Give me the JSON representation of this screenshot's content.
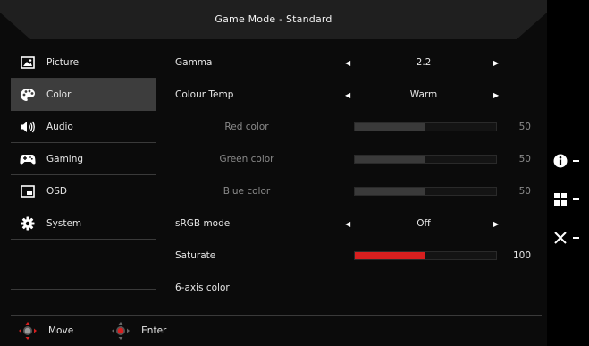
{
  "header": {
    "title": "Game Mode - Standard"
  },
  "sidebar": {
    "items": [
      {
        "label": "Picture",
        "icon": "picture-icon",
        "active": false
      },
      {
        "label": "Color",
        "icon": "palette-icon",
        "active": true
      },
      {
        "label": "Audio",
        "icon": "speaker-icon",
        "active": false
      },
      {
        "label": "Gaming",
        "icon": "gamepad-icon",
        "active": false
      },
      {
        "label": "OSD",
        "icon": "osd-icon",
        "active": false
      },
      {
        "label": "System",
        "icon": "gear-icon",
        "active": false
      }
    ]
  },
  "settings": {
    "gamma": {
      "label": "Gamma",
      "value": "2.2"
    },
    "colour_temp": {
      "label": "Colour Temp",
      "value": "Warm"
    },
    "red": {
      "label": "Red color",
      "value": "50",
      "level": 50
    },
    "green": {
      "label": "Green color",
      "value": "50",
      "level": 50
    },
    "blue": {
      "label": "Blue color",
      "value": "50",
      "level": 50
    },
    "srgb": {
      "label": "sRGB mode",
      "value": "Off"
    },
    "saturate": {
      "label": "Saturate",
      "value": "100",
      "level": 50
    },
    "six_axis": {
      "label": "6-axis color"
    }
  },
  "footer": {
    "move_label": "Move",
    "enter_label": "Enter"
  },
  "hotkeys": [
    "info-icon",
    "grid-icon",
    "close-icon"
  ],
  "colors": {
    "accent": "#d71f1f",
    "panel": "#0b0b0b",
    "active": "#3d3d3d"
  }
}
